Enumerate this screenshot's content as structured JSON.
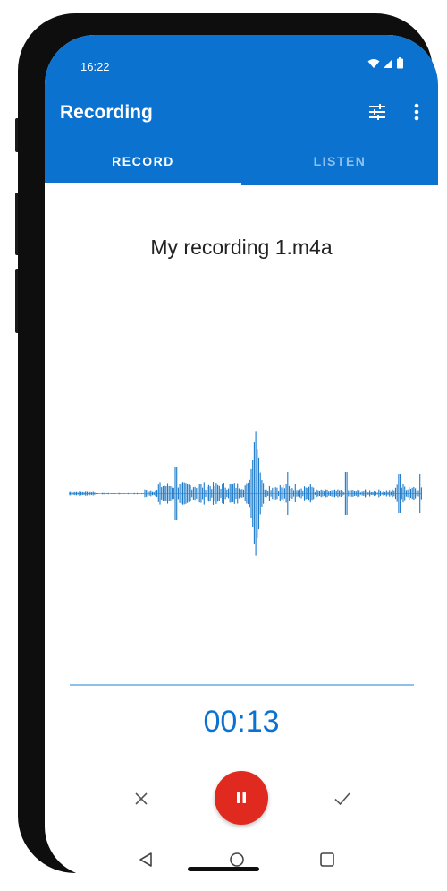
{
  "status_bar": {
    "time": "16:22",
    "icons": [
      "wifi-icon",
      "signal-icon",
      "battery-icon"
    ]
  },
  "app_bar": {
    "title": "Recording",
    "actions": [
      "tune-icon",
      "more-vert-icon"
    ]
  },
  "tabs": [
    {
      "label": "RECORD",
      "selected": true
    },
    {
      "label": "LISTEN",
      "selected": false
    }
  ],
  "recording": {
    "file_name": "My recording 1.m4a",
    "elapsed": "00:13"
  },
  "controls": {
    "cancel": "close-icon",
    "pause": "pause-icon",
    "done": "check-icon"
  },
  "nav_bar": [
    "back-icon",
    "home-icon",
    "recents-icon"
  ],
  "colors": {
    "primary": "#0b73cf",
    "tab_inactive": "#8fc0ec",
    "record_red": "#e12a1f",
    "waveform": "#1a7acb"
  }
}
